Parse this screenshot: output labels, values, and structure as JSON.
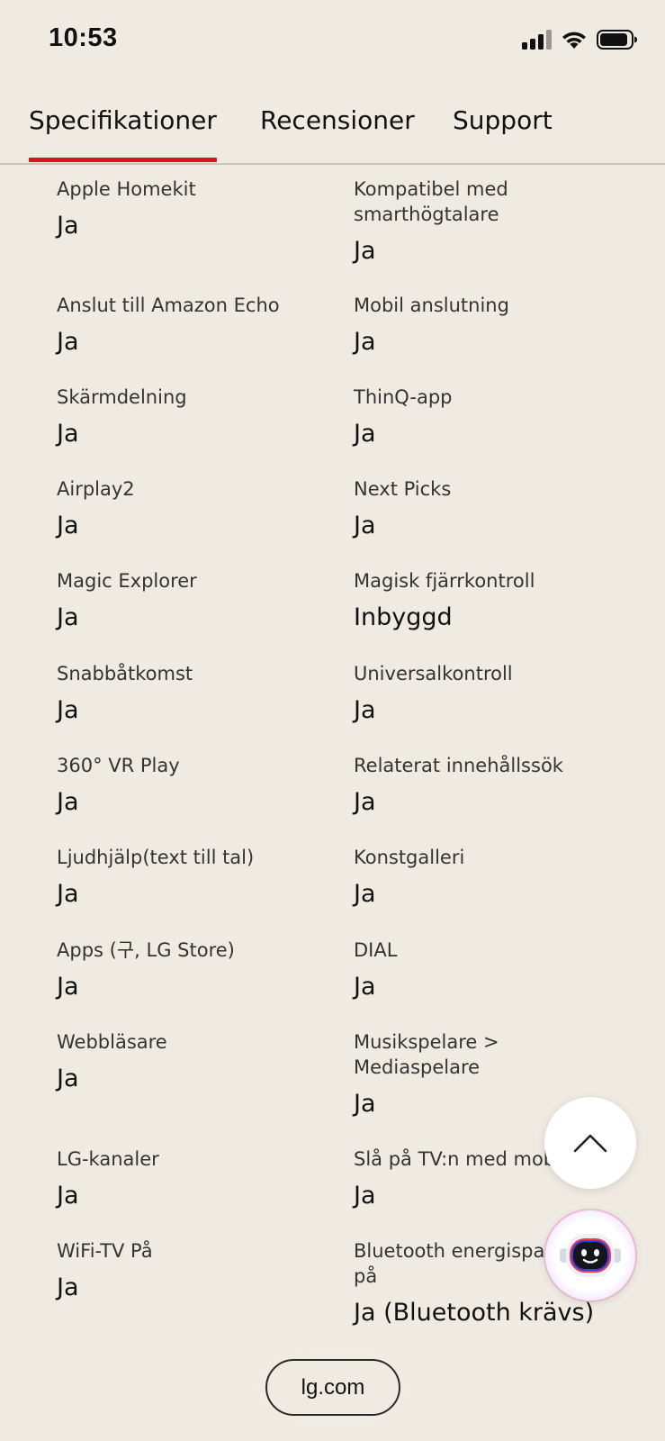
{
  "status": {
    "time": "10:53",
    "icons": [
      "cellular-signal-icon",
      "wifi-icon",
      "battery-icon"
    ]
  },
  "tabs": [
    {
      "label": "Specifikationer",
      "active": true
    },
    {
      "label": "Recensioner",
      "active": false
    },
    {
      "label": "Support",
      "active": false
    }
  ],
  "specs": [
    {
      "left": {
        "label": "Apple Homekit",
        "value": "Ja"
      },
      "right": {
        "label": "Kompatibel med\nsmarthögtalare",
        "value": "Ja"
      }
    },
    {
      "left": {
        "label": "Anslut till Amazon Echo",
        "value": "Ja"
      },
      "right": {
        "label": "Mobil anslutning",
        "value": "Ja"
      }
    },
    {
      "left": {
        "label": "Skärmdelning",
        "value": "Ja"
      },
      "right": {
        "label": "ThinQ-app",
        "value": "Ja"
      }
    },
    {
      "left": {
        "label": "Airplay2",
        "value": "Ja"
      },
      "right": {
        "label": "Next Picks",
        "value": "Ja"
      }
    },
    {
      "left": {
        "label": "Magic Explorer",
        "value": "Ja"
      },
      "right": {
        "label": "Magisk fjärrkontroll",
        "value": "Inbyggd"
      }
    },
    {
      "left": {
        "label": "Snabbåtkomst",
        "value": "Ja"
      },
      "right": {
        "label": "Universalkontroll",
        "value": "Ja"
      }
    },
    {
      "left": {
        "label": "360° VR Play",
        "value": "Ja"
      },
      "right": {
        "label": "Relaterat innehållssök",
        "value": "Ja"
      }
    },
    {
      "left": {
        "label": "Ljudhjälp(text till tal)",
        "value": "Ja"
      },
      "right": {
        "label": "Konstgalleri",
        "value": "Ja"
      }
    },
    {
      "left": {
        "label": "Apps (구, LG Store)",
        "value": "Ja"
      },
      "right": {
        "label": "DIAL",
        "value": "Ja"
      }
    },
    {
      "left": {
        "label": "Webbläsare",
        "value": "Ja"
      },
      "right": {
        "label": "Musikspelare >\nMediaspelare",
        "value": "Ja"
      }
    },
    {
      "left": {
        "label": "LG-kanaler",
        "value": "Ja"
      },
      "right": {
        "label": "Slå på TV:n med mobil",
        "value": "Ja"
      }
    },
    {
      "left": {
        "label": "WiFi-TV På",
        "value": "Ja"
      },
      "right": {
        "label": "Bluetooth energisparläge\npå",
        "value": "Ja (Bluetooth krävs)"
      }
    }
  ],
  "buttons": {
    "scroll_top_icon": "chevron-up-icon",
    "chatbot_icon": "chatbot-robot-icon"
  },
  "browser": {
    "url": "lg.com"
  },
  "colors": {
    "background": "#f0ebe2",
    "accent": "#d1181f"
  }
}
